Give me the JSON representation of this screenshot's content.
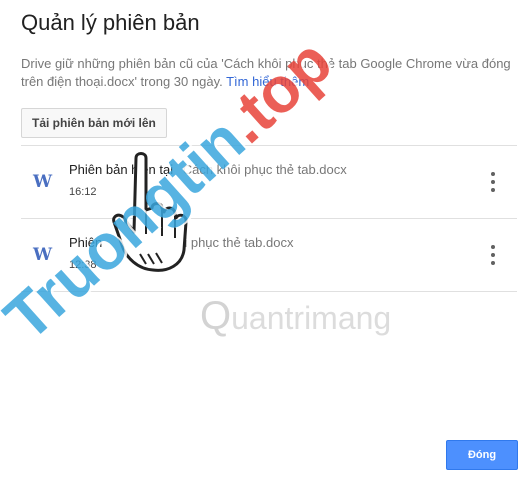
{
  "dialog": {
    "title": "Quản lý phiên bản",
    "description_text": "Drive giữ những phiên bản cũ của 'Cách khôi phục thẻ tab Google Chrome vừa đóng trên điện thoại.docx' trong 30 ngày.",
    "learn_more": "Tìm hiểu thêm",
    "upload_button": "Tải phiên bản mới lên",
    "close_button": "Đóng"
  },
  "versions": [
    {
      "icon": "W",
      "label": "Phiên bản hiện tại",
      "filename": "Cách khôi phục thẻ tab.docx",
      "time": "16:12"
    },
    {
      "icon": "W",
      "label": "Phiên",
      "filename": "hôi phục thẻ tab.docx",
      "time": "12:38"
    }
  ],
  "watermark": {
    "main": "Truongtin",
    "accent": ".top",
    "sub": "uantrimang"
  },
  "colors": {
    "accent_blue": "#4d90fe",
    "link": "#3367d6",
    "word_icon": "#4a6fc1",
    "watermark_blue": "#3aa6dd",
    "watermark_red": "#e8443a"
  }
}
